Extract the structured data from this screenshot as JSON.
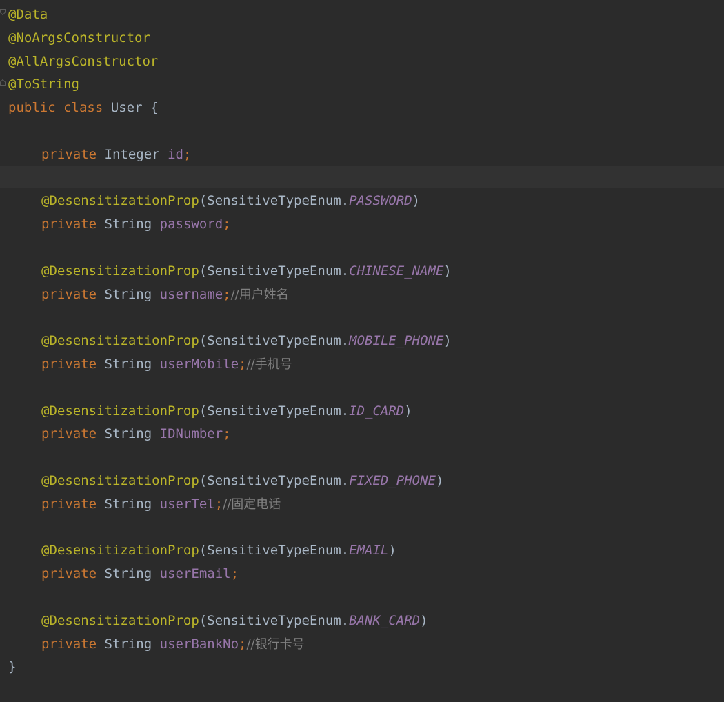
{
  "code": {
    "class_annotations": [
      "@Data",
      "@NoArgsConstructor",
      "@AllArgsConstructor",
      "@ToString"
    ],
    "class_decl": {
      "modifier": "public",
      "keyword": "class",
      "name": "User",
      "open": "{"
    },
    "id_field": {
      "modifier": "private",
      "type": "Integer",
      "name": "id",
      "semi": ";"
    },
    "annotated_fields": [
      {
        "annotation": "@DesensitizationProp",
        "enum_class": "SensitiveTypeEnum.",
        "enum_const": "PASSWORD",
        "modifier": "private",
        "type": "String",
        "name": "password",
        "semi": ";",
        "comment": ""
      },
      {
        "annotation": "@DesensitizationProp",
        "enum_class": "SensitiveTypeEnum.",
        "enum_const": "CHINESE_NAME",
        "modifier": "private",
        "type": "String",
        "name": "username",
        "semi": ";",
        "comment": "//用户姓名"
      },
      {
        "annotation": "@DesensitizationProp",
        "enum_class": "SensitiveTypeEnum.",
        "enum_const": "MOBILE_PHONE",
        "modifier": "private",
        "type": "String",
        "name": "userMobile",
        "semi": ";",
        "comment": "//手机号"
      },
      {
        "annotation": "@DesensitizationProp",
        "enum_class": "SensitiveTypeEnum.",
        "enum_const": "ID_CARD",
        "modifier": "private",
        "type": "String",
        "name": "IDNumber",
        "semi": ";",
        "comment": ""
      },
      {
        "annotation": "@DesensitizationProp",
        "enum_class": "SensitiveTypeEnum.",
        "enum_const": "FIXED_PHONE",
        "modifier": "private",
        "type": "String",
        "name": "userTel",
        "semi": ";",
        "comment": "//固定电话"
      },
      {
        "annotation": "@DesensitizationProp",
        "enum_class": "SensitiveTypeEnum.",
        "enum_const": "EMAIL",
        "modifier": "private",
        "type": "String",
        "name": "userEmail",
        "semi": ";",
        "comment": ""
      },
      {
        "annotation": "@DesensitizationProp",
        "enum_class": "SensitiveTypeEnum.",
        "enum_const": "BANK_CARD",
        "modifier": "private",
        "type": "String",
        "name": "userBankNo",
        "semi": ";",
        "comment": "//银行卡号"
      }
    ],
    "close_brace": "}"
  },
  "colors": {
    "background": "#2b2b2b",
    "current_line": "#323232",
    "annotation": "#bbb529",
    "keyword": "#cc7832",
    "field": "#9876aa",
    "comment": "#808080",
    "default_text": "#a9b7c6"
  },
  "icons": {
    "fold_marker": "fold-marker-icon"
  }
}
